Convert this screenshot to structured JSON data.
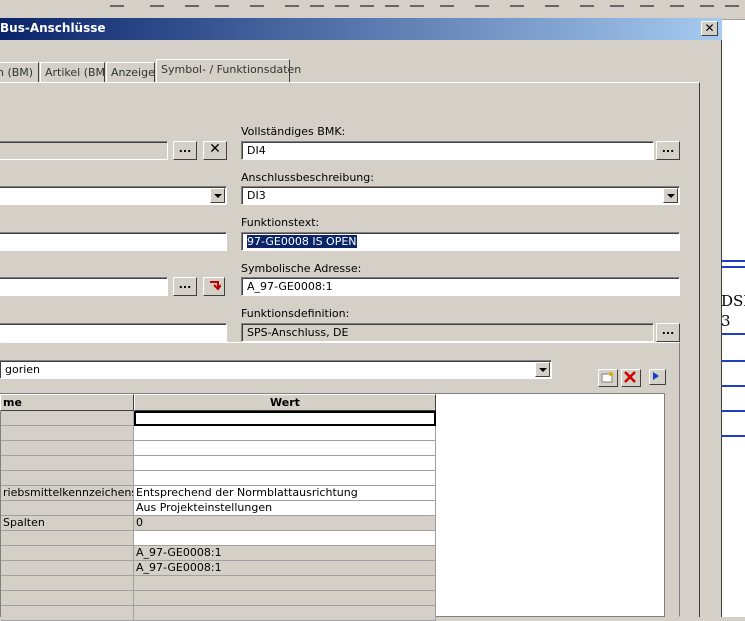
{
  "dialog": {
    "title": "Bus-Anschlüsse",
    "close_glyph": "✕"
  },
  "tabs": [
    {
      "label": "n (BM)"
    },
    {
      "label": "Artikel (BM)"
    },
    {
      "label": "Anzeige"
    },
    {
      "label": "Symbol- / Funktionsdaten"
    }
  ],
  "form": {
    "bmk_label": "Vollständiges BMK:",
    "bmk_value": "DI4",
    "anschluss_label": "Anschlussbeschreibung:",
    "anschluss_value": "DI3",
    "funktionstext_label": "Funktionstext:",
    "funktionstext_value": "97-GE0008 IS OPEN",
    "symbadr_label": "Symbolische Adresse:",
    "symbadr_value": "A_97-GE0008:1",
    "funkdef_label": "Funktionsdefinition:",
    "funkdef_value": "SPS-Anschluss, DE",
    "browse_glyph": "...",
    "clear_glyph": "✕"
  },
  "properties": {
    "category_value": "gorien",
    "col_name": "me",
    "col_value": "Wert",
    "rows": [
      {
        "name": "",
        "value": "",
        "gray": false
      },
      {
        "name": "",
        "value": "",
        "gray": false
      },
      {
        "name": "",
        "value": "",
        "gray": false
      },
      {
        "name": "",
        "value": "",
        "gray": false
      },
      {
        "name": "",
        "value": "",
        "gray": false
      },
      {
        "name": "riebsmittelkennzeichens",
        "value": "Entsprechend der Normblattausrichtung",
        "gray": false
      },
      {
        "name": "",
        "value": "Aus Projekteinstellungen",
        "gray": false
      },
      {
        "name": " Spalten",
        "value": "0",
        "gray": true
      },
      {
        "name": "",
        "value": "",
        "gray": false
      },
      {
        "name": "",
        "value": "A_97-GE0008:1",
        "gray": true
      },
      {
        "name": "",
        "value": "A_97-GE0008:1",
        "gray": true
      },
      {
        "name": "",
        "value": "",
        "gray": true
      },
      {
        "name": "",
        "value": "",
        "gray": true
      },
      {
        "name": "",
        "value": "",
        "gray": true
      }
    ]
  },
  "host": {
    "text_1": "DSE",
    "text_2": "3"
  }
}
